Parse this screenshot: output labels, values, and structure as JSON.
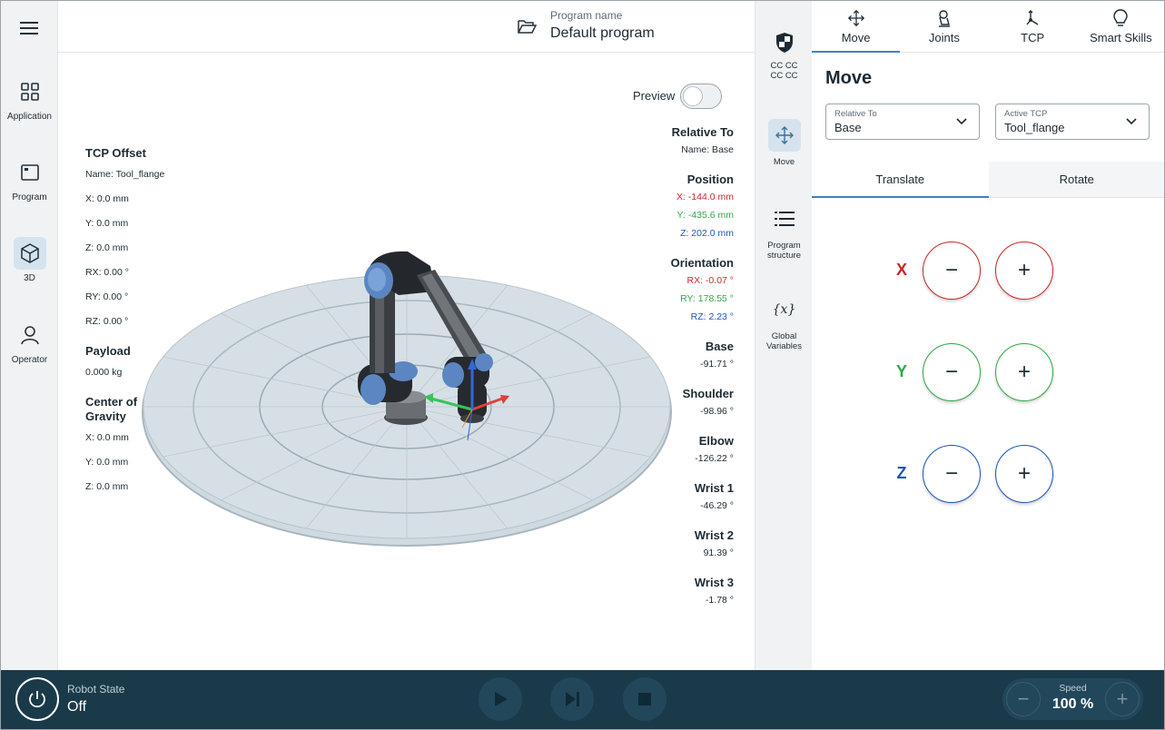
{
  "leftnav": {
    "items": [
      {
        "label": "Application",
        "icon": "grid-icon"
      },
      {
        "label": "Program",
        "icon": "program-window-icon"
      },
      {
        "label": "3D",
        "icon": "cube-icon"
      },
      {
        "label": "Operator",
        "icon": "user-icon"
      }
    ],
    "active": "3D"
  },
  "header": {
    "program_label": "Program name",
    "program_name": "Default program"
  },
  "viewport": {
    "preview_label": "Preview",
    "preview_on": false,
    "tcp_offset": {
      "title": "TCP Offset",
      "name": "Name: Tool_flange",
      "x": "X: 0.0 mm",
      "y": "Y: 0.0 mm",
      "z": "Z: 0.0 mm",
      "rx": "RX: 0.00 °",
      "ry": "RY: 0.00 °",
      "rz": "RZ: 0.00 °"
    },
    "payload": {
      "title": "Payload",
      "value": "0.000 kg"
    },
    "cog": {
      "title": "Center of Gravity",
      "x": "X: 0.0 mm",
      "y": "Y: 0.0 mm",
      "z": "Z: 0.0 mm"
    },
    "relative_to": {
      "title": "Relative To",
      "name": "Name: Base"
    },
    "position": {
      "title": "Position",
      "x": "X: -144.0 mm",
      "y": "Y: -435.6 mm",
      "z": "Z: 202.0 mm"
    },
    "orientation": {
      "title": "Orientation",
      "rx": "RX: -0.07 °",
      "ry": "RY: 178.55 °",
      "rz": "RZ: 2.23 °"
    },
    "joints": [
      {
        "name": "Base",
        "value": "-91.71 °"
      },
      {
        "name": "Shoulder",
        "value": "-98.96 °"
      },
      {
        "name": "Elbow",
        "value": "-126.22 °"
      },
      {
        "name": "Wrist 1",
        "value": "-46.29 °"
      },
      {
        "name": "Wrist 2",
        "value": "91.39 °"
      },
      {
        "name": "Wrist 3",
        "value": "-1.78 °"
      }
    ]
  },
  "sidenav": {
    "safety_text": "CC CC\nCC CC",
    "items": [
      {
        "label": "Move"
      },
      {
        "label": "Program structure"
      },
      {
        "label": "Global Variables"
      }
    ]
  },
  "panel": {
    "tabs": [
      {
        "label": "Move",
        "icon": "move-arrows-icon"
      },
      {
        "label": "Joints",
        "icon": "joint-icon"
      },
      {
        "label": "TCP",
        "icon": "tcp-axes-icon"
      },
      {
        "label": "Smart Skills",
        "icon": "lightbulb-icon"
      }
    ],
    "active_tab": "Move",
    "title": "Move",
    "relative_to": {
      "label": "Relative To",
      "value": "Base"
    },
    "active_tcp": {
      "label": "Active TCP",
      "value": "Tool_flange"
    },
    "subtabs": [
      "Translate",
      "Rotate"
    ],
    "active_subtab": "Translate",
    "axes": [
      {
        "label": "X",
        "color": "#c82828"
      },
      {
        "label": "Y",
        "color": "#2fa843"
      },
      {
        "label": "Z",
        "color": "#1b56b8"
      }
    ],
    "minus": "−",
    "plus": "+"
  },
  "bottombar": {
    "robot_state_label": "Robot State",
    "robot_state_value": "Off",
    "speed_label": "Speed",
    "speed_value": "100 %",
    "minus": "−",
    "plus": "+"
  },
  "colors": {
    "accent": "#3c82c4",
    "bottombar": "#1a3a4a",
    "x_axis": "#c82828",
    "y_axis": "#2fa843",
    "z_axis": "#1b56b8"
  }
}
